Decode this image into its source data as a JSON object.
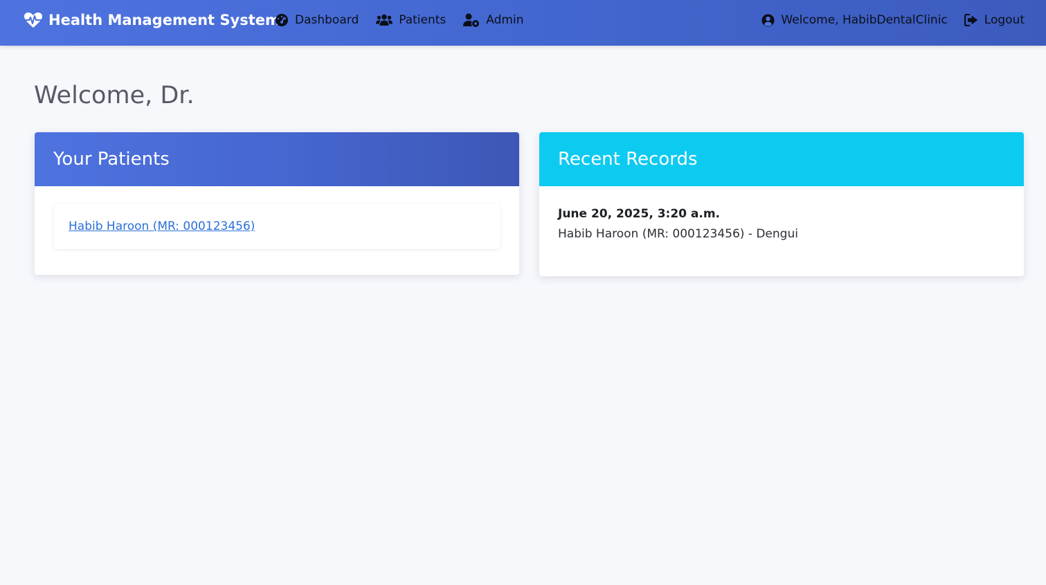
{
  "app": {
    "brand": "Health Management System",
    "brand_icon": "heart-pulse-icon"
  },
  "nav": {
    "items": [
      {
        "label": "Dashboard",
        "icon": "gauge-icon"
      },
      {
        "label": "Patients",
        "icon": "users-icon"
      },
      {
        "label": "Admin",
        "icon": "user-cog-icon"
      }
    ],
    "welcome": "Welcome, HabibDentalClinic",
    "welcome_icon": "user-circle-icon",
    "logout": "Logout",
    "logout_icon": "sign-out-icon"
  },
  "page": {
    "title": "Welcome, Dr."
  },
  "patients_card": {
    "title": "Your Patients",
    "patients": [
      {
        "label": "Habib Haroon (MR: 000123456)"
      }
    ]
  },
  "records_card": {
    "title": "Recent Records",
    "records": [
      {
        "date": "June 20, 2025, 3:20 a.m.",
        "text": "Habib Haroon (MR: 000123456) - Dengui"
      }
    ]
  },
  "colors": {
    "navbar": "#4e73df",
    "records_header": "#0dcaf0",
    "link": "#2a6fd6",
    "background": "#f7f8fc"
  }
}
